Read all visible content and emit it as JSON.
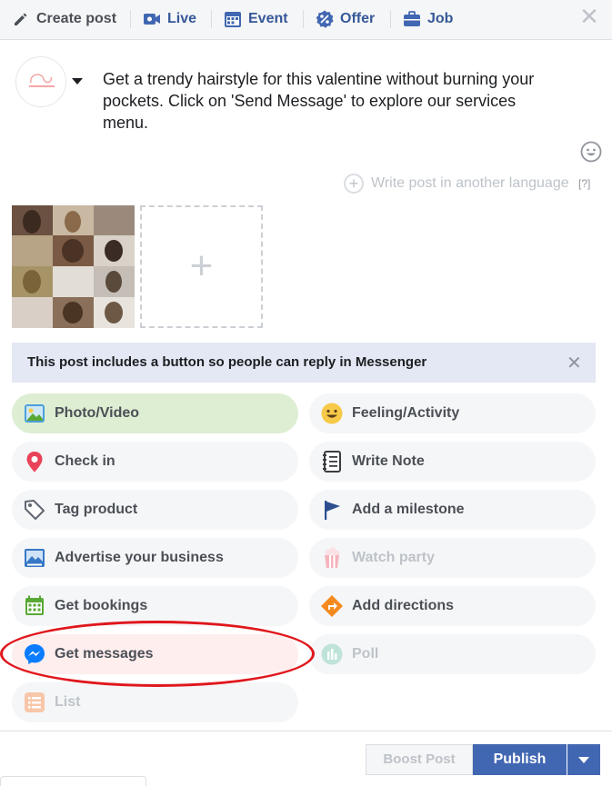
{
  "tabs": [
    {
      "label": "Create post",
      "icon": "pencil-icon"
    },
    {
      "label": "Live",
      "icon": "video-camera-icon"
    },
    {
      "label": "Event",
      "icon": "calendar-icon"
    },
    {
      "label": "Offer",
      "icon": "percent-badge-icon"
    },
    {
      "label": "Job",
      "icon": "briefcase-icon"
    }
  ],
  "composer": {
    "post_text": "Get a trendy hairstyle for this valentine without burning your pockets. Click on 'Send Message' to explore our services menu.",
    "language_prompt": "Write post in another language",
    "language_help": "[?]"
  },
  "banner": {
    "text": "This post includes a button so people can reply in Messenger"
  },
  "options": [
    {
      "label": "Photo/Video",
      "icon": "photo-icon"
    },
    {
      "label": "Feeling/Activity",
      "icon": "smiley-icon"
    },
    {
      "label": "Check in",
      "icon": "location-pin-icon"
    },
    {
      "label": "Write Note",
      "icon": "notebook-icon"
    },
    {
      "label": "Tag product",
      "icon": "price-tag-icon"
    },
    {
      "label": "Add a milestone",
      "icon": "flag-icon"
    },
    {
      "label": "Advertise your business",
      "icon": "advertise-icon"
    },
    {
      "label": "Watch party",
      "icon": "popcorn-icon"
    },
    {
      "label": "Get bookings",
      "icon": "calendar-grid-icon"
    },
    {
      "label": "Add directions",
      "icon": "directions-icon"
    },
    {
      "label": "Get messages",
      "icon": "messenger-icon"
    },
    {
      "label": "Poll",
      "icon": "poll-icon"
    },
    {
      "label": "List",
      "icon": "list-icon"
    }
  ],
  "footer": {
    "boost_label": "Boost Post",
    "publish_label": "Publish"
  },
  "colors": {
    "brand_blue": "#4267b2",
    "link_blue": "#365899",
    "highlight_oval": "#e0161c"
  }
}
